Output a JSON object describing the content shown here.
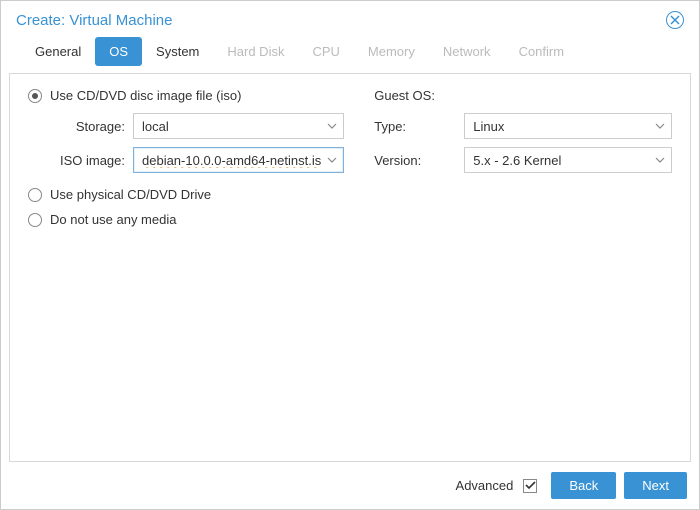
{
  "title": "Create: Virtual Machine",
  "tabs": [
    {
      "label": "General"
    },
    {
      "label": "OS"
    },
    {
      "label": "System"
    },
    {
      "label": "Hard Disk"
    },
    {
      "label": "CPU"
    },
    {
      "label": "Memory"
    },
    {
      "label": "Network"
    },
    {
      "label": "Confirm"
    }
  ],
  "left": {
    "radio_iso": "Use CD/DVD disc image file (iso)",
    "radio_physical": "Use physical CD/DVD Drive",
    "radio_none": "Do not use any media",
    "storage_label": "Storage:",
    "storage_value": "local",
    "iso_label": "ISO image:",
    "iso_value": "debian-10.0.0-amd64-netinst.is"
  },
  "right": {
    "header": "Guest OS:",
    "type_label": "Type:",
    "type_value": "Linux",
    "version_label": "Version:",
    "version_value": "5.x - 2.6 Kernel"
  },
  "footer": {
    "advanced": "Advanced",
    "back": "Back",
    "next": "Next"
  }
}
